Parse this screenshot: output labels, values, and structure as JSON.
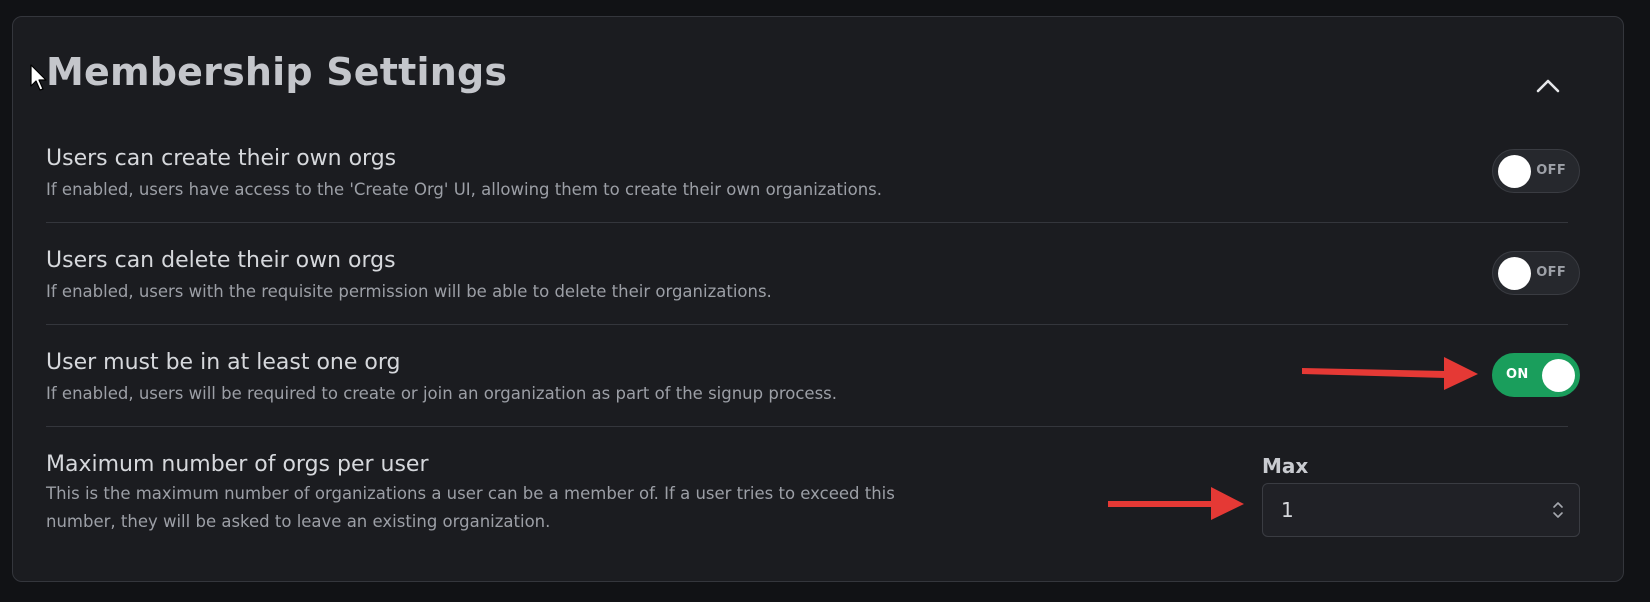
{
  "section": {
    "title": "Membership Settings"
  },
  "settings": [
    {
      "title": "Users can create their own orgs",
      "description": "If enabled, users have access to the 'Create Org' UI, allowing them to create their own organizations.",
      "toggle": {
        "state": "off",
        "label": "OFF"
      }
    },
    {
      "title": "Users can delete their own orgs",
      "description": "If enabled, users with the requisite permission will be able to delete their organizations.",
      "toggle": {
        "state": "off",
        "label": "OFF"
      }
    },
    {
      "title": "User must be in at least one org",
      "description": "If enabled, users will be required to create or join an organization as part of the signup process.",
      "toggle": {
        "state": "on",
        "label": "ON"
      }
    },
    {
      "title": "Maximum number of orgs per user",
      "description": "This is the maximum number of organizations a user can be a member of. If a user tries to exceed this number, they will be asked to leave an existing organization.",
      "input": {
        "label": "Max",
        "value": "1"
      }
    }
  ],
  "colors": {
    "background": "#111215",
    "panel": "#1b1c20",
    "toggle_on": "#1a9e5c",
    "annotation_arrow": "#e53935"
  },
  "icons": {
    "collapse": "chevron-up-icon",
    "stepper": "up-down-chevron-icon",
    "cursor": "mouse-cursor-icon",
    "annotation": "red-arrow-icon"
  }
}
